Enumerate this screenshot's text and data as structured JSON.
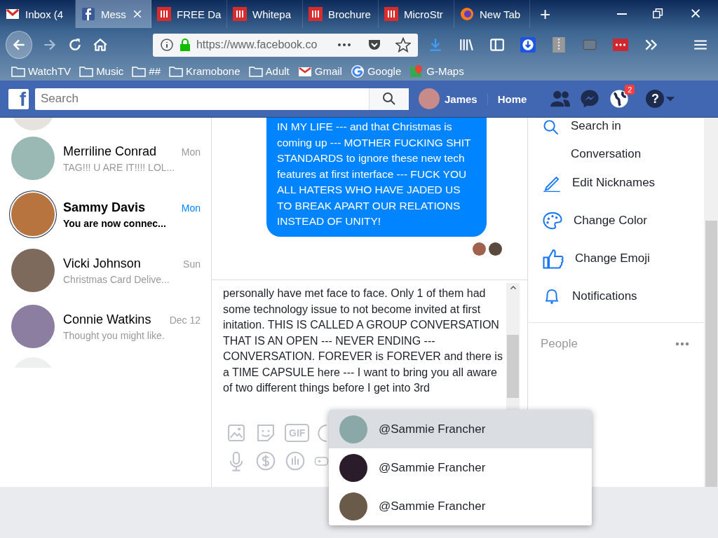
{
  "browser": {
    "tabs": [
      {
        "label": "Inbox (4",
        "selected": false,
        "kind": "gmail"
      },
      {
        "label": "Mess",
        "selected": true,
        "kind": "facebook"
      },
      {
        "label": "FREE Da",
        "selected": false,
        "kind": "red"
      },
      {
        "label": "Whitepa",
        "selected": false,
        "kind": "red"
      },
      {
        "label": "Brochure",
        "selected": false,
        "kind": "red"
      },
      {
        "label": "MicroStr",
        "selected": false,
        "kind": "red"
      },
      {
        "label": "New Tab",
        "selected": false,
        "kind": "firefox"
      }
    ],
    "new_tab": "+",
    "address": "https://www.facebook.co",
    "bookmarks": [
      {
        "label": "WatchTV",
        "kind": "folder"
      },
      {
        "label": "Music",
        "kind": "folder"
      },
      {
        "label": "##",
        "kind": "folder"
      },
      {
        "label": "Kramobone",
        "kind": "folder"
      },
      {
        "label": "Adult",
        "kind": "folder"
      },
      {
        "label": "Gmail",
        "kind": "gmail"
      },
      {
        "label": "Google",
        "kind": "google"
      },
      {
        "label": "G-Maps",
        "kind": "maps"
      }
    ]
  },
  "header": {
    "logo": "f",
    "search_placeholder": "Search",
    "user": "James",
    "home": "Home",
    "notification_count": "2",
    "help": "?"
  },
  "conversations": [
    {
      "name": "Merriline Conrad",
      "preview": "TAG!!! U ARE IT!!!! LOL...",
      "time": "Mon",
      "unread": false
    },
    {
      "name": "Sammy Davis",
      "preview": "You are now connec...",
      "time": "Mon",
      "unread": true
    },
    {
      "name": "Vicki Johnson",
      "preview": "Christmas Card Delive...",
      "time": "Sun",
      "unread": false
    },
    {
      "name": "Connie Watkins",
      "preview": "Thought you might like.",
      "time": "Dec 12",
      "unread": false
    }
  ],
  "chat": {
    "message": "IN MY LIFE --- and that Christmas is coming up --- MOTHER FUCKING SHIT STANDARDS to ignore these new tech features at first interface --- FUCK YOU ALL HATERS WHO HAVE JADED US TO BREAK APART OUR RELATIONS INSTEAD OF UNITY!",
    "composer_text": "personally have met face to face.  Only 1 of them had some technology issue to not become invited at first initation.  THIS IS CALLED A GROUP CONVERSATION THAT IS AN OPEN --- NEVER ENDING --- CONVERSATION.  FOREVER is FOREVER and there is a TIME CAPSULE here --- I want to bring you all aware of two different things before I get into 3rd",
    "gif_label": "GIF"
  },
  "options": [
    {
      "label": "Search in Conversation",
      "kind": "search"
    },
    {
      "label": "Edit Nicknames",
      "kind": "pencil"
    },
    {
      "label": "Change Color",
      "kind": "palette"
    },
    {
      "label": "Change Emoji",
      "kind": "thumb"
    },
    {
      "label": "Notifications",
      "kind": "bell"
    }
  ],
  "people": {
    "title": "People"
  },
  "mentions": [
    {
      "label": "@Sammie Francher",
      "selected": true
    },
    {
      "label": "@Sammie Francher",
      "selected": false
    },
    {
      "label": "@Sammie Francher",
      "selected": false
    }
  ]
}
